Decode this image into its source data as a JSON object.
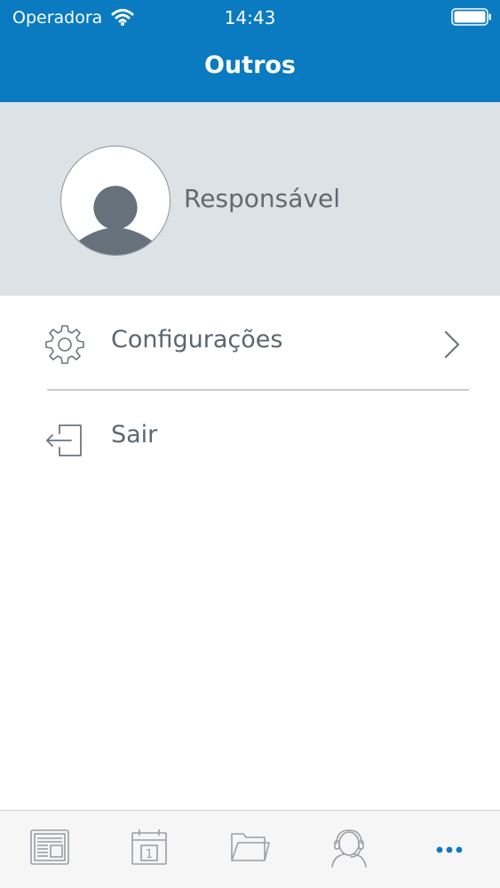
{
  "status_bar": {
    "carrier": "Operadora",
    "time": "14:43"
  },
  "nav": {
    "title": "Outros"
  },
  "profile": {
    "name": "Responsável"
  },
  "menu": {
    "items": [
      {
        "label": "Configurações",
        "icon": "gear-icon",
        "has_chevron": true
      },
      {
        "label": "Sair",
        "icon": "logout-icon",
        "has_chevron": false
      }
    ]
  },
  "tabbar": {
    "tabs": [
      {
        "icon": "news-icon",
        "active": false
      },
      {
        "icon": "calendar-icon",
        "active": false,
        "badge_text": "1"
      },
      {
        "icon": "folder-icon",
        "active": false
      },
      {
        "icon": "support-agent-icon",
        "active": false
      },
      {
        "icon": "more-dots-icon",
        "active": true
      }
    ]
  },
  "colors": {
    "header_blue": "#0a7ac1",
    "profile_bg": "#dde2e7",
    "text_gray": "#5b6670",
    "tab_icon_gray": "#9a9fa4",
    "tab_active": "#0a7ac1"
  }
}
